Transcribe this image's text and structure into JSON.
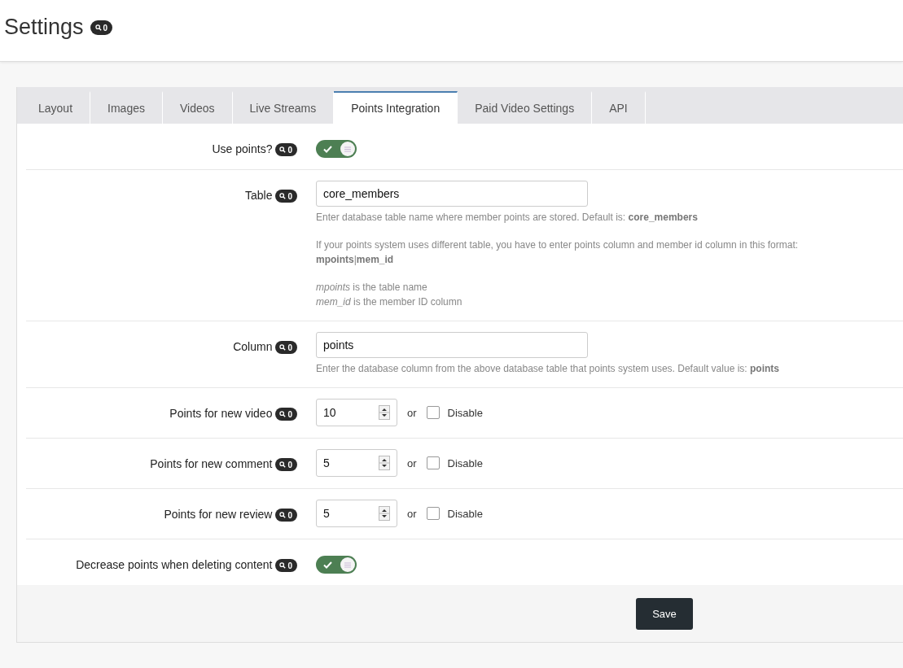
{
  "page": {
    "title": "Settings",
    "badge": "0"
  },
  "tabs": [
    {
      "label": "Layout",
      "selected": false
    },
    {
      "label": "Images",
      "selected": false
    },
    {
      "label": "Videos",
      "selected": false
    },
    {
      "label": "Live Streams",
      "selected": false
    },
    {
      "label": "Points Integration",
      "selected": true
    },
    {
      "label": "Paid Video Settings",
      "selected": false
    },
    {
      "label": "API",
      "selected": false
    }
  ],
  "rows": [
    {
      "kind": "toggle",
      "label": "Use points?",
      "badge": "0",
      "on": true
    },
    {
      "kind": "text",
      "label": "Table",
      "badge": "0",
      "value": "core_members",
      "help": [
        "Enter database table name where member points are stored. Default is: **core_members**",
        "If your points system uses different table, you have to enter points column and member id column in this format:\n**mpoints**|**mem_id**",
        "*mpoints* is the table name\n*mem_id* is the member ID column"
      ]
    },
    {
      "kind": "text",
      "label": "Column",
      "badge": "0",
      "value": "points",
      "help": [
        "Enter the database column from the above database table that points system uses. Default value is: **points**"
      ]
    },
    {
      "kind": "number",
      "label": "Points for new video",
      "badge": "0",
      "value": "10",
      "or": "or",
      "disable_label": "Disable",
      "checked": false
    },
    {
      "kind": "number",
      "label": "Points for new comment",
      "badge": "0",
      "value": "5",
      "or": "or",
      "disable_label": "Disable",
      "checked": false
    },
    {
      "kind": "number",
      "label": "Points for new review",
      "badge": "0",
      "value": "5",
      "or": "or",
      "disable_label": "Disable",
      "checked": false
    },
    {
      "kind": "toggle",
      "label": "Decrease points when deleting content",
      "badge": "0",
      "on": true
    }
  ],
  "save_button": "Save"
}
